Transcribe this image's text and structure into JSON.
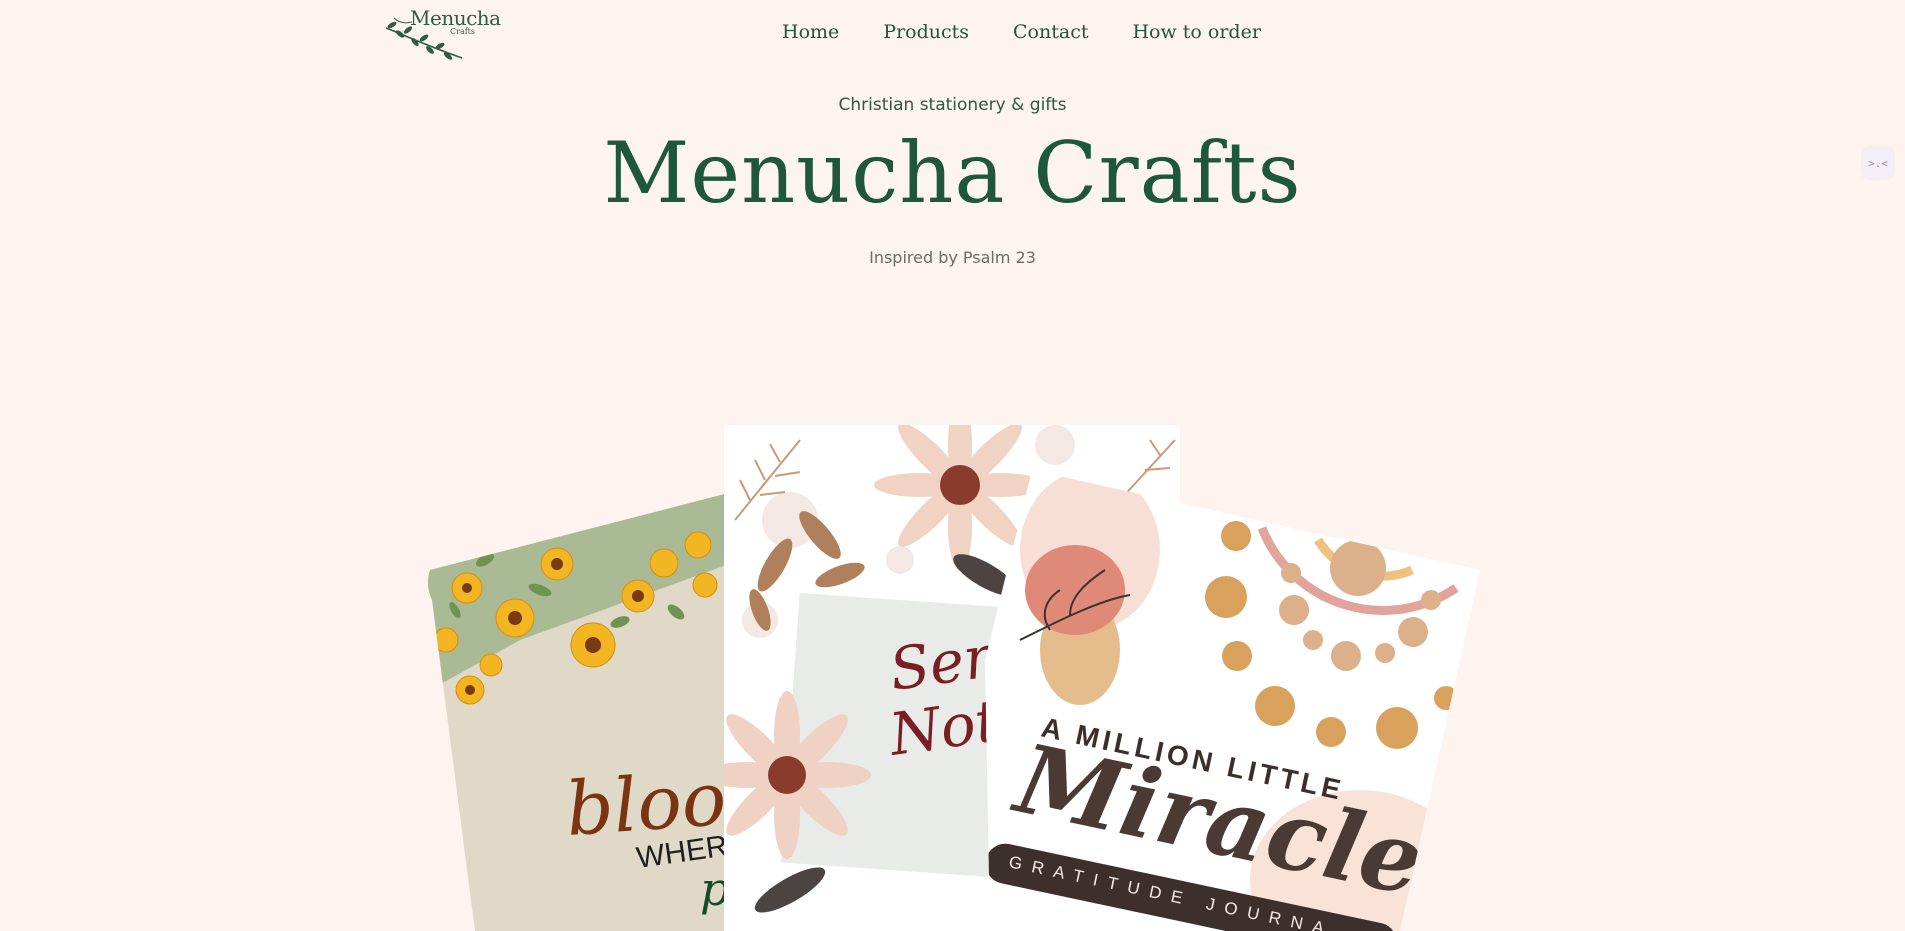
{
  "brand": {
    "logo_name": "Menucha",
    "logo_sub": "Crafts"
  },
  "nav": {
    "items": [
      "Home",
      "Products",
      "Contact",
      "How to order"
    ]
  },
  "hero": {
    "tagline": "Christian stationery & gifts",
    "title": "Menucha Crafts",
    "inspired": "Inspired by  Psalm 23"
  },
  "extension_icon": {
    "label": ">.<"
  },
  "products": {
    "card1": {
      "script": "bloom",
      "text": "WHERE YO",
      "tail": "p"
    },
    "card2": {
      "script_line1": "Serm",
      "script_line2": "Not"
    },
    "card3": {
      "line1": "A MILLION LITTLE",
      "script": "Miracles",
      "band": "GRATITUDE JOURNA"
    }
  },
  "colors": {
    "background": "#fdf4f0",
    "brand_green": "#1f573d",
    "muted_text": "#6d6b66"
  }
}
